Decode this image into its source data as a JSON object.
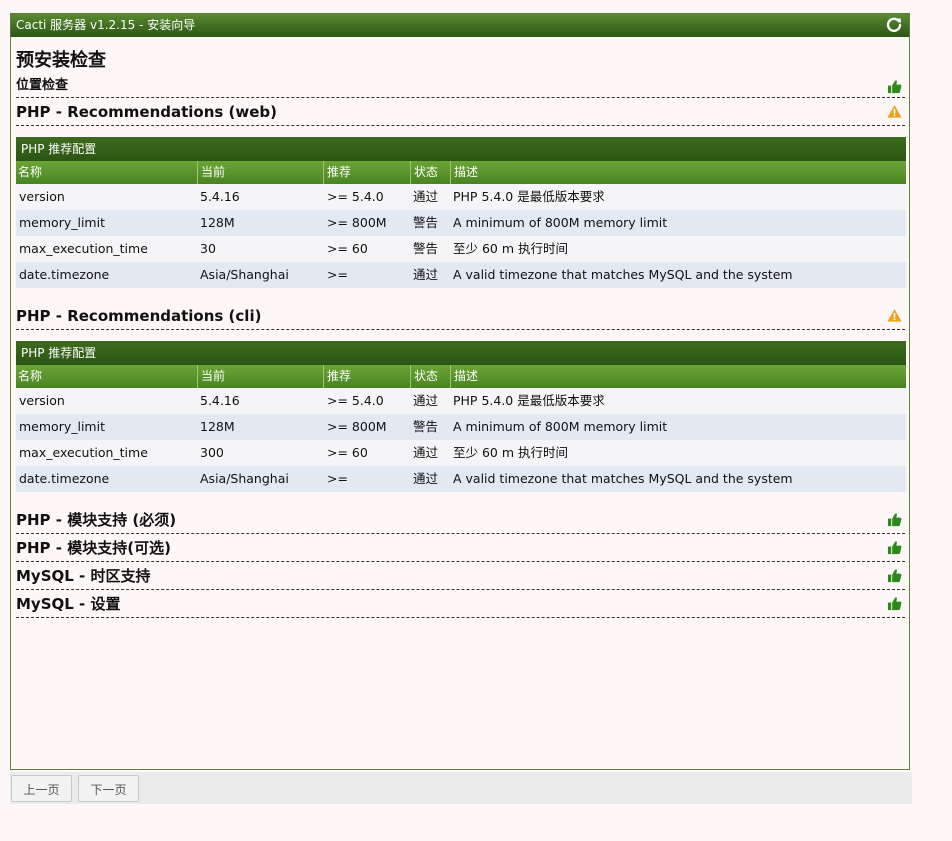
{
  "window": {
    "title": "Cacti 服务器 v1.2.15 - 安装向导",
    "refresh_icon": "refresh-icon"
  },
  "page": {
    "heading": "预安装检查"
  },
  "location_check": {
    "label": "位置检查",
    "status_icon": "thumbs-up-icon"
  },
  "php_web": {
    "label": "PHP - Recommendations (web)",
    "status_icon": "warning-icon",
    "table": {
      "title": "PHP 推荐配置",
      "headers": [
        "名称",
        "当前",
        "推荐",
        "状态",
        "描述"
      ],
      "rows": [
        [
          "version",
          "5.4.16",
          ">= 5.4.0",
          "通过",
          "PHP 5.4.0 是最低版本要求"
        ],
        [
          "memory_limit",
          "128M",
          ">= 800M",
          "警告",
          "A minimum of 800M memory limit"
        ],
        [
          "max_execution_time",
          "30",
          ">= 60",
          "警告",
          "至少 60 m 执行时间"
        ],
        [
          "date.timezone",
          "Asia/Shanghai",
          ">=",
          "通过",
          "A valid timezone that matches MySQL and the system"
        ]
      ]
    }
  },
  "php_cli": {
    "label": "PHP - Recommendations (cli)",
    "status_icon": "warning-icon",
    "table": {
      "title": "PHP 推荐配置",
      "headers": [
        "名称",
        "当前",
        "推荐",
        "状态",
        "描述"
      ],
      "rows": [
        [
          "version",
          "5.4.16",
          ">= 5.4.0",
          "通过",
          "PHP 5.4.0 是最低版本要求"
        ],
        [
          "memory_limit",
          "128M",
          ">= 800M",
          "警告",
          "A minimum of 800M memory limit"
        ],
        [
          "max_execution_time",
          "300",
          ">= 60",
          "通过",
          "至少 60 m 执行时间"
        ],
        [
          "date.timezone",
          "Asia/Shanghai",
          ">=",
          "通过",
          "A valid timezone that matches MySQL and the system"
        ]
      ]
    }
  },
  "sections": [
    {
      "label": "PHP - 模块支持 (必须)",
      "status_icon": "thumbs-up-icon"
    },
    {
      "label": "PHP - 模块支持(可选)",
      "status_icon": "thumbs-up-icon"
    },
    {
      "label": "MySQL - 时区支持",
      "status_icon": "thumbs-up-icon"
    },
    {
      "label": "MySQL - 设置",
      "status_icon": "thumbs-up-icon"
    }
  ],
  "footer": {
    "prev_label": "上一页",
    "next_label": "下一页"
  },
  "colors": {
    "title_bar": "#3f6d21",
    "table_header": "#5a962c",
    "ok": "#2e8b1a",
    "warn": "#f0a01a"
  }
}
